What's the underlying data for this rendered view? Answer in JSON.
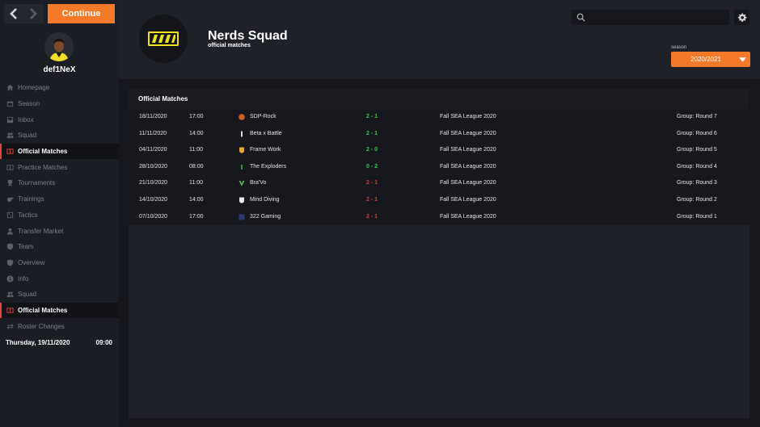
{
  "sidebar": {
    "continue_label": "Continue",
    "user_name": "def1NeX",
    "items": [
      {
        "label": "Homepage",
        "icon": "home-icon",
        "active": false
      },
      {
        "label": "Season",
        "icon": "calendar-icon",
        "active": false
      },
      {
        "label": "Inbox",
        "icon": "inbox-icon",
        "active": false
      },
      {
        "label": "Squad",
        "icon": "users-icon",
        "active": false
      },
      {
        "label": "Official Matches",
        "icon": "matches-icon",
        "active": true
      },
      {
        "label": "Practice Matches",
        "icon": "matches-icon",
        "active": false
      },
      {
        "label": "Tournaments",
        "icon": "trophy-icon",
        "active": false
      },
      {
        "label": "Trainings",
        "icon": "whistle-icon",
        "active": false
      },
      {
        "label": "Tactics",
        "icon": "tactics-icon",
        "active": false
      },
      {
        "label": "Transfer Market",
        "icon": "transfer-icon",
        "active": false
      },
      {
        "label": "Team",
        "icon": "shield-icon",
        "active": false
      },
      {
        "label": "Overview",
        "icon": "shield-icon",
        "active": false
      },
      {
        "label": "Info",
        "icon": "info-icon",
        "active": false
      },
      {
        "label": "Squad",
        "icon": "users-icon",
        "active": false
      },
      {
        "label": "Official Matches",
        "icon": "matches-icon",
        "active": true
      },
      {
        "label": "Roster Changes",
        "icon": "swap-icon",
        "active": false
      }
    ],
    "date": "Thursday, 19/11/2020",
    "time": "09:00"
  },
  "header": {
    "club_name": "Nerds Squad",
    "club_subtitle": "official matches",
    "search_placeholder": "",
    "season_label": "season",
    "season_value": "2020/2021"
  },
  "panel": {
    "title": "Official Matches",
    "matches": [
      {
        "date": "18/11/2020",
        "time": "17:00",
        "opponent": "SDP-Rock",
        "logo_color": "#c8612c",
        "score": "2 - 1",
        "result": "win",
        "league": "Fall SEA League 2020",
        "round": "Group: Round 7"
      },
      {
        "date": "11/11/2020",
        "time": "14:00",
        "opponent": "Beta x Battle",
        "logo_color": "#d9d9d9",
        "score": "2 - 1",
        "result": "win",
        "league": "Fall SEA League 2020",
        "round": "Group: Round 6"
      },
      {
        "date": "04/11/2020",
        "time": "11:00",
        "opponent": "Frame Work",
        "logo_color": "#e8a43a",
        "score": "2 - 0",
        "result": "win",
        "league": "Fall SEA League 2020",
        "round": "Group: Round 5"
      },
      {
        "date": "28/10/2020",
        "time": "08:00",
        "opponent": "The Exploders",
        "logo_color": "#3bb34a",
        "score": "0 - 2",
        "result": "win",
        "league": "Fall SEA League 2020",
        "round": "Group: Round 4"
      },
      {
        "date": "21/10/2020",
        "time": "11:00",
        "opponent": "Bra'Vo",
        "logo_color": "#5fc05a",
        "score": "2 - 1",
        "result": "loss",
        "league": "Fall SEA League 2020",
        "round": "Group: Round 3"
      },
      {
        "date": "14/10/2020",
        "time": "14:00",
        "opponent": "Mind Diving",
        "logo_color": "#e8e8e8",
        "score": "2 - 1",
        "result": "loss",
        "league": "Fall SEA League 2020",
        "round": "Group: Round 2"
      },
      {
        "date": "07/10/2020",
        "time": "17:00",
        "opponent": "322 Gaming",
        "logo_color": "#2b3a6e",
        "score": "2 - 1",
        "result": "loss",
        "league": "Fall SEA League 2020",
        "round": "Group: Round 1"
      }
    ]
  },
  "colors": {
    "accent": "#f47a2a",
    "active_marker": "#e0483b",
    "win": "#2fd04a",
    "loss": "#e2373a"
  }
}
